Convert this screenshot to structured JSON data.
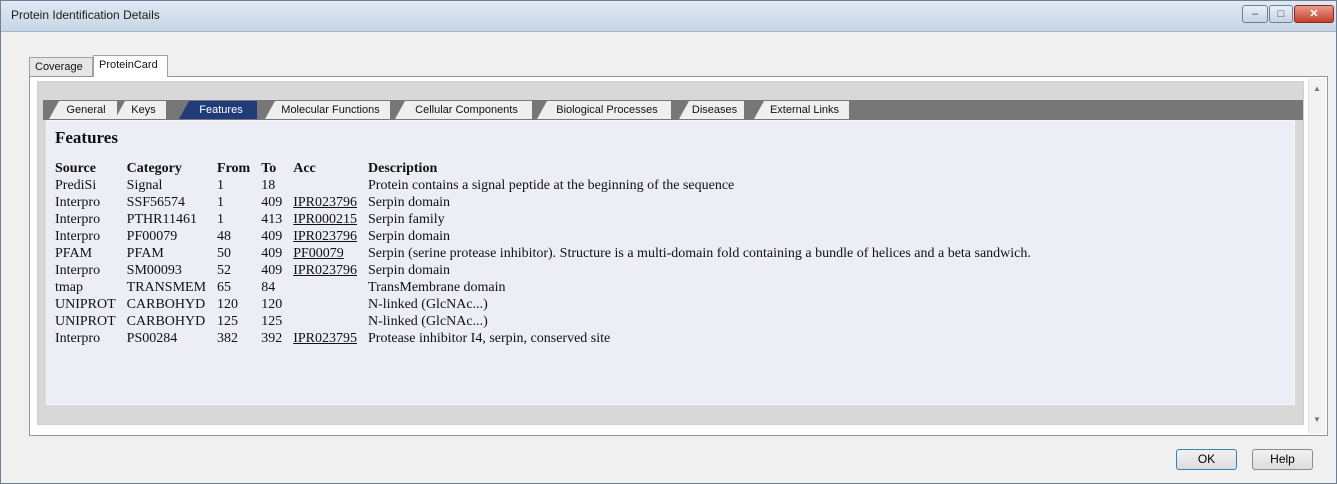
{
  "window": {
    "title": "Protein Identification Details",
    "controls": {
      "minimize": "–",
      "maximize": "□",
      "close": "✕"
    }
  },
  "outer_tabs": [
    "Coverage",
    "ProteinCard"
  ],
  "inner_tabs": [
    {
      "label": "General"
    },
    {
      "label": "Keys"
    },
    {
      "label": "Features"
    },
    {
      "label": "Molecular Functions"
    },
    {
      "label": "Cellular Components"
    },
    {
      "label": "Biological Processes"
    },
    {
      "label": "Diseases"
    },
    {
      "label": "External Links"
    }
  ],
  "active_inner_tab": "Features",
  "features": {
    "title": "Features",
    "columns": [
      "Source",
      "Category",
      "From",
      "To",
      "Acc",
      "Description"
    ],
    "rows": [
      {
        "source": "PrediSi",
        "category": "Signal",
        "from": "1",
        "to": "18",
        "acc": "",
        "description": "Protein contains a signal peptide at the beginning of the sequence"
      },
      {
        "source": "Interpro",
        "category": "SSF56574",
        "from": "1",
        "to": "409",
        "acc": "IPR023796",
        "description": "Serpin domain"
      },
      {
        "source": "Interpro",
        "category": "PTHR11461",
        "from": "1",
        "to": "413",
        "acc": "IPR000215",
        "description": "Serpin family"
      },
      {
        "source": "Interpro",
        "category": "PF00079",
        "from": "48",
        "to": "409",
        "acc": "IPR023796",
        "description": "Serpin domain"
      },
      {
        "source": "PFAM",
        "category": "PFAM",
        "from": "50",
        "to": "409",
        "acc": "PF00079",
        "description": "Serpin (serine protease inhibitor). Structure is a multi-domain fold containing a bundle of helices and a beta sandwich."
      },
      {
        "source": "Interpro",
        "category": "SM00093",
        "from": "52",
        "to": "409",
        "acc": "IPR023796",
        "description": "Serpin domain"
      },
      {
        "source": "tmap",
        "category": "TRANSMEM",
        "from": "65",
        "to": "84",
        "acc": "",
        "description": "TransMembrane domain"
      },
      {
        "source": "UNIPROT",
        "category": "CARBOHYD",
        "from": "120",
        "to": "120",
        "acc": "",
        "description": "N-linked (GlcNAc...)"
      },
      {
        "source": "UNIPROT",
        "category": "CARBOHYD",
        "from": "125",
        "to": "125",
        "acc": "",
        "description": "N-linked (GlcNAc...)"
      },
      {
        "source": "Interpro",
        "category": "PS00284",
        "from": "382",
        "to": "392",
        "acc": "IPR023795",
        "description": "Protease inhibitor I4, serpin, conserved site"
      }
    ]
  },
  "buttons": {
    "ok": "OK",
    "help": "Help"
  },
  "colors": {
    "active_tab": "#1f3c78",
    "tab_strip": "#777777",
    "panel_bg": "#ecedf5"
  }
}
